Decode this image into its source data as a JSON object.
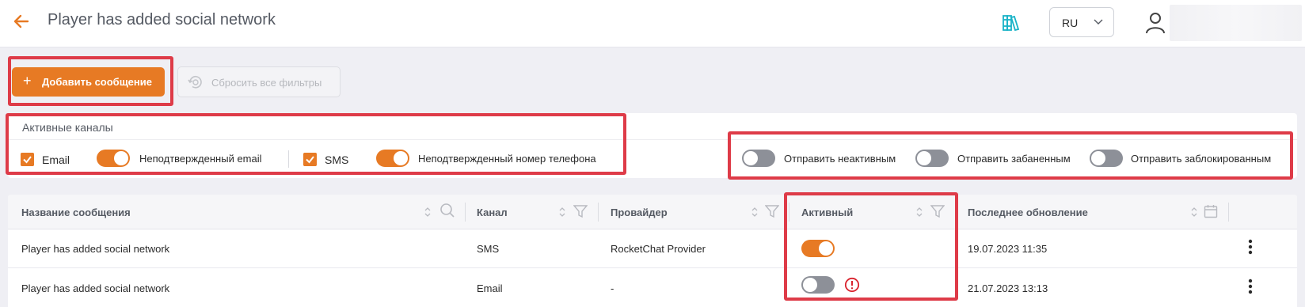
{
  "header": {
    "title": "Player has added social network",
    "language": "RU",
    "icons": [
      "arrow-left-icon",
      "books-icon",
      "chevron-down-icon",
      "user-icon"
    ],
    "accent_color": "#e77a24",
    "docs_icon_color": "#1ab3c7"
  },
  "toolbar": {
    "add_label": "Добавить сообщение",
    "add_icon": "+",
    "reset_label": "Сбросить все фильтры"
  },
  "channels": {
    "title": "Активные каналы",
    "email_label": "Email",
    "email_checked": true,
    "email_unconfirmed_label": "Неподтвержденный email",
    "email_unconfirmed_on": true,
    "sms_label": "SMS",
    "sms_checked": true,
    "sms_unconfirmed_label": "Неподтвержденный номер телефона",
    "sms_unconfirmed_on": true,
    "send_inactive_label": "Отправить неактивным",
    "send_inactive_on": false,
    "send_banned_label": "Отправить забаненным",
    "send_banned_on": false,
    "send_blocked_label": "Отправить заблокированным",
    "send_blocked_on": false
  },
  "table": {
    "columns": [
      "Название сообщения",
      "Канал",
      "Провайдер",
      "Активный",
      "Последнее обновление"
    ],
    "rows": [
      {
        "name": "Player has added social network",
        "channel": "SMS",
        "provider": "RocketChat Provider",
        "active": true,
        "warning": false,
        "updated": "19.07.2023 11:35"
      },
      {
        "name": "Player has added social network",
        "channel": "Email",
        "provider": "-",
        "active": false,
        "warning": true,
        "updated": "21.07.2023 13:13"
      }
    ]
  },
  "highlight_color": "#de3b48"
}
